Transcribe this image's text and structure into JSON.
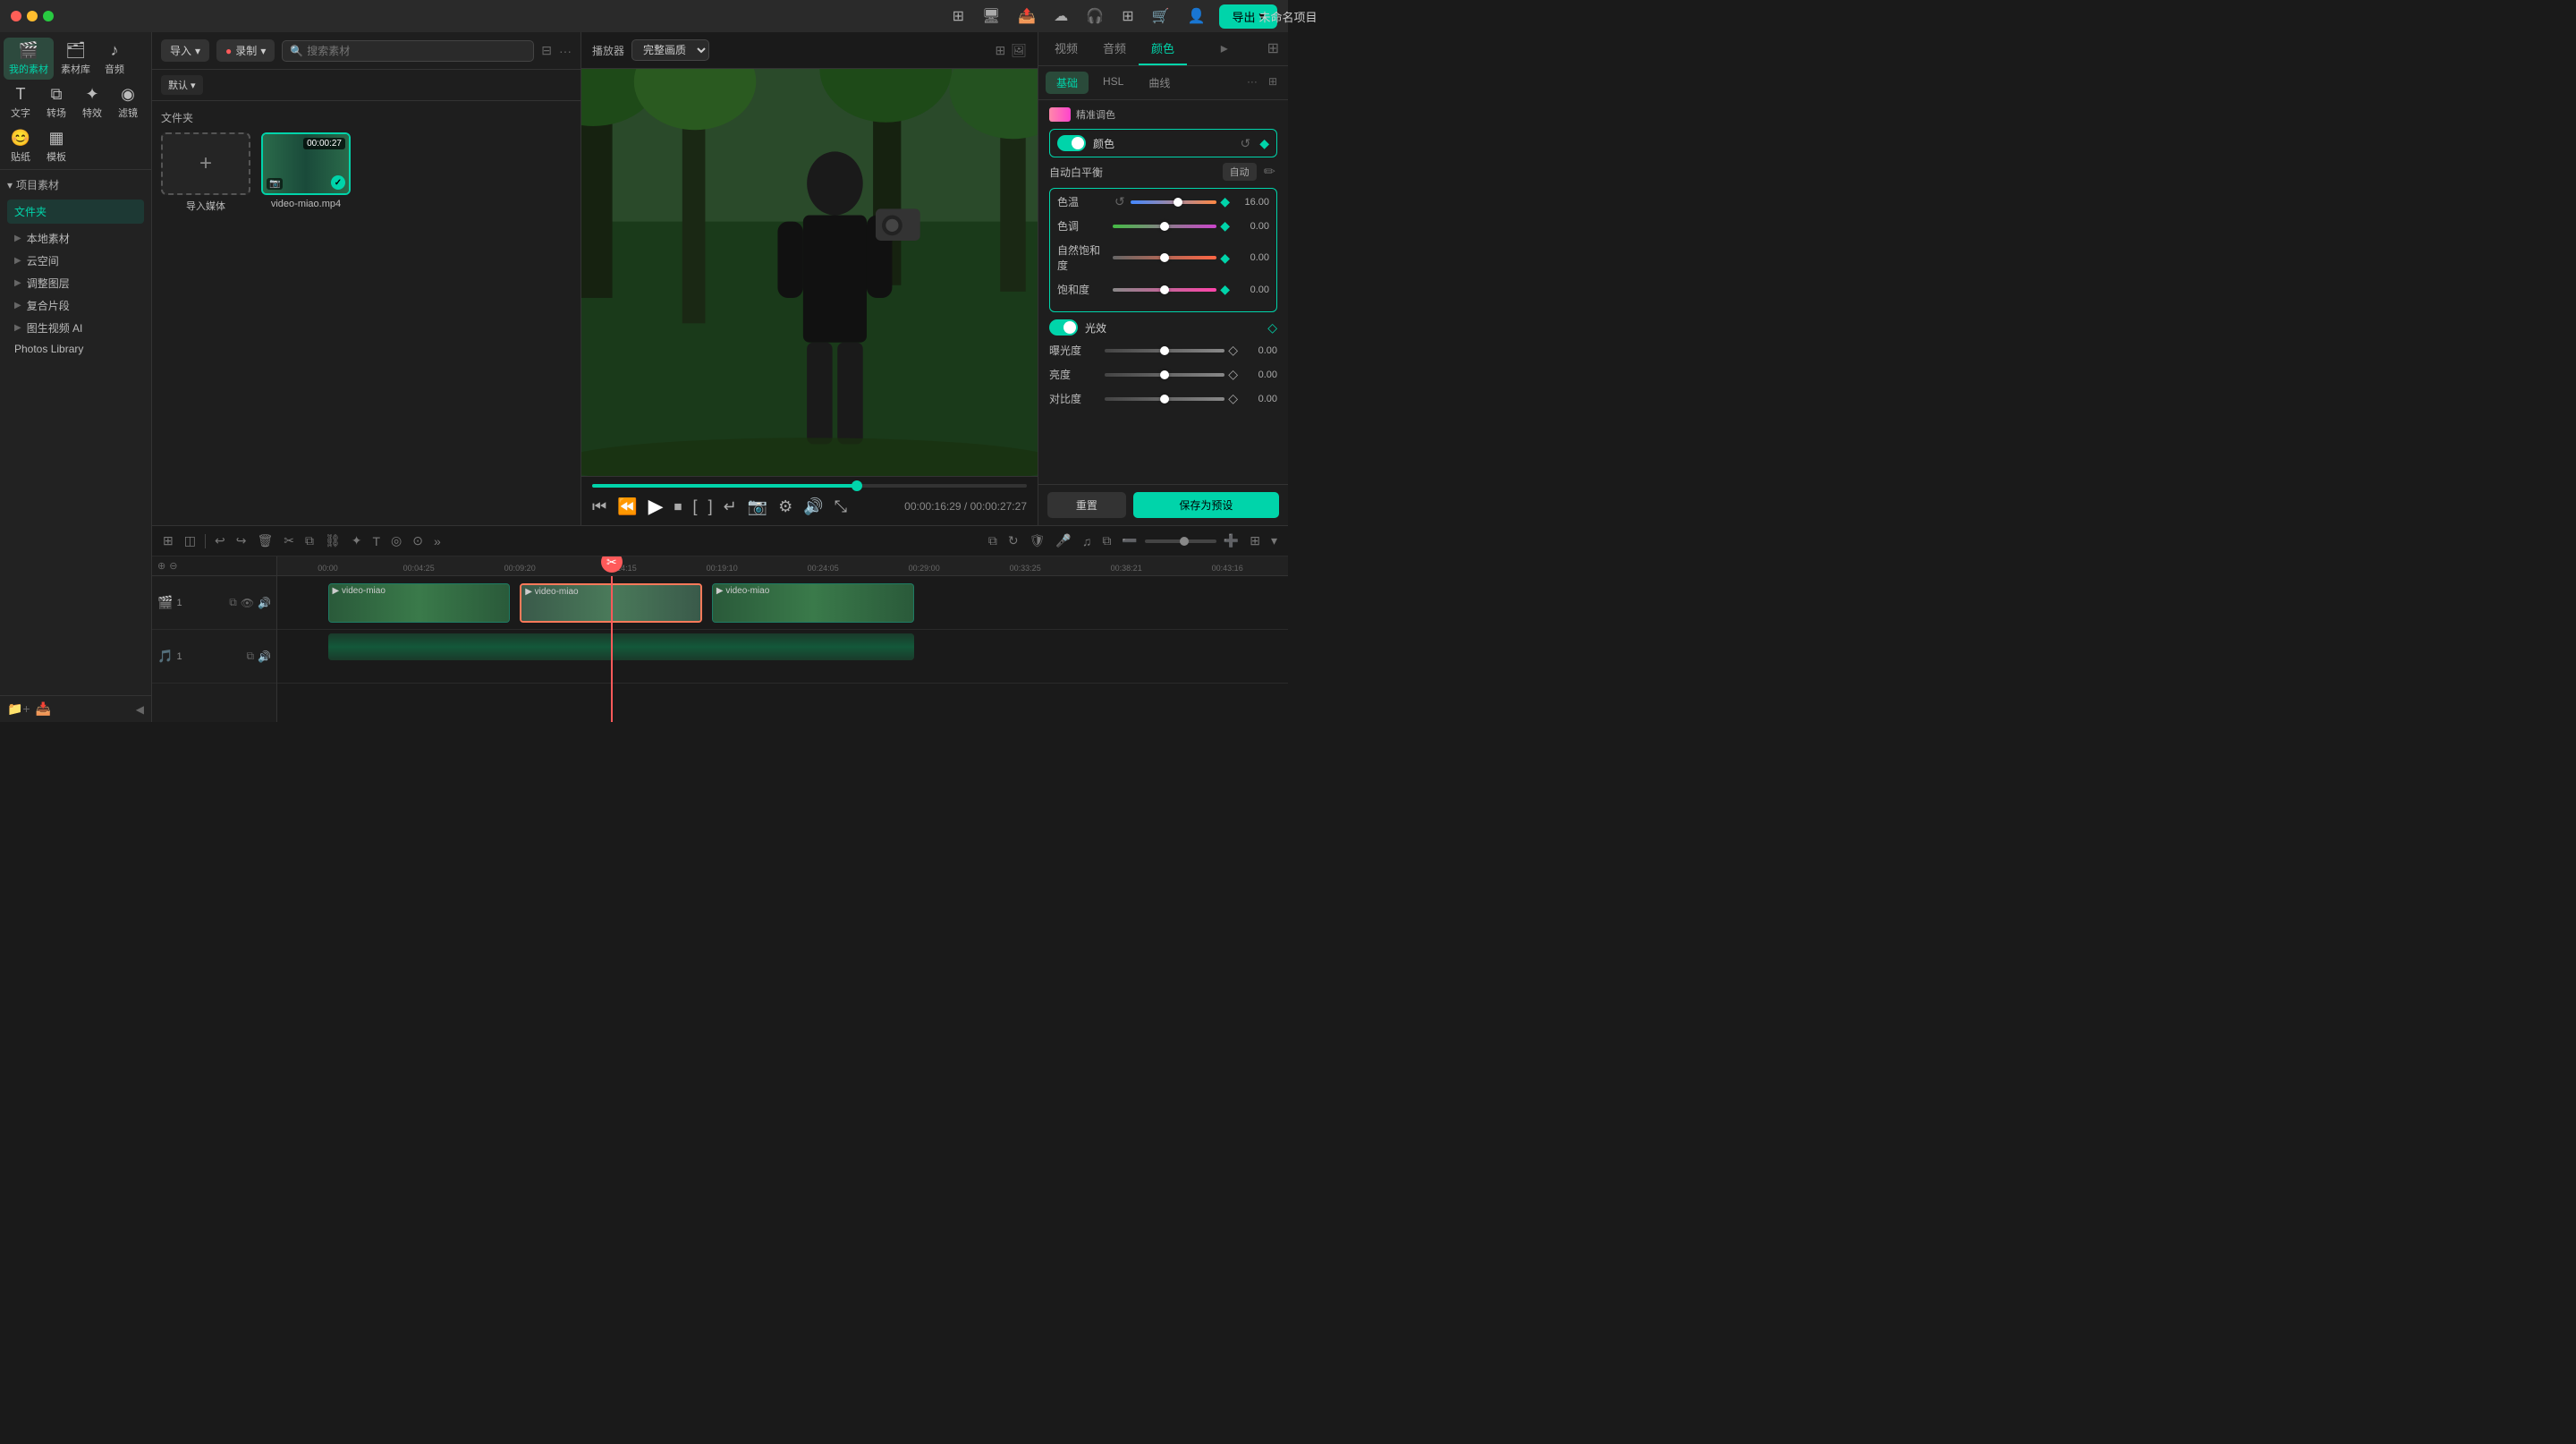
{
  "app": {
    "title": "未命名项目",
    "export_label": "导出",
    "traffic_lights": [
      "close",
      "minimize",
      "maximize"
    ]
  },
  "nav": {
    "items": [
      {
        "id": "my-material",
        "icon": "🎬",
        "label": "我的素材",
        "active": true
      },
      {
        "id": "material-lib",
        "icon": "🗂",
        "label": "素材库",
        "active": false
      },
      {
        "id": "audio",
        "icon": "🎵",
        "label": "音频",
        "active": false
      },
      {
        "id": "text",
        "icon": "T",
        "label": "文字",
        "active": false
      },
      {
        "id": "transition",
        "icon": "▶",
        "label": "转场",
        "active": false
      },
      {
        "id": "effects",
        "icon": "✨",
        "label": "特效",
        "active": false
      },
      {
        "id": "filters",
        "icon": "🔵",
        "label": "滤镜",
        "active": false
      },
      {
        "id": "sticker",
        "icon": "😊",
        "label": "贴纸",
        "active": false
      },
      {
        "id": "template",
        "icon": "□",
        "label": "模板",
        "active": false
      }
    ]
  },
  "sidebar": {
    "project_label": "项目素材",
    "folder_label": "文件夹",
    "items": [
      {
        "label": "本地素材",
        "has_arrow": true
      },
      {
        "label": "云空间",
        "has_arrow": true
      },
      {
        "label": "调整图层",
        "has_arrow": true
      },
      {
        "label": "复合片段",
        "has_arrow": true
      },
      {
        "label": "图生视频 AI",
        "has_arrow": true
      },
      {
        "label": "Photos Library",
        "has_arrow": false
      }
    ]
  },
  "media": {
    "import_label": "导入",
    "record_label": "录制",
    "sort_label": "默认",
    "search_placeholder": "搜索素材",
    "folder_label": "文件夹",
    "items": [
      {
        "type": "import",
        "label": "导入媒体"
      },
      {
        "type": "video",
        "name": "video-miao.mp4",
        "duration": "00:00:27",
        "has_check": true,
        "has_cam": true
      }
    ]
  },
  "preview": {
    "label": "播放器",
    "quality": "完整画质",
    "current_time": "00:00:16:29",
    "total_time": "00:00:27:27",
    "progress_percent": 61
  },
  "color_panel": {
    "tabs": [
      {
        "label": "视频",
        "active": false
      },
      {
        "label": "音频",
        "active": false
      },
      {
        "label": "颜色",
        "active": true
      }
    ],
    "sub_tabs": [
      {
        "label": "基础",
        "active": true
      },
      {
        "label": "HSL",
        "active": false
      },
      {
        "label": "曲线",
        "active": false
      }
    ],
    "color_section": {
      "toggle_label": "颜色",
      "auto_wb_label": "自动白平衡",
      "auto_btn_label": "自动",
      "sliders": [
        {
          "label": "色温",
          "value": "16.00",
          "percent": 55,
          "type": "temp"
        },
        {
          "label": "色调",
          "value": "0.00",
          "percent": 50,
          "type": "tint"
        },
        {
          "label": "自然饱和度",
          "value": "0.00",
          "percent": 50,
          "type": "vibrance"
        },
        {
          "label": "饱和度",
          "value": "0.00",
          "percent": 50,
          "type": "saturation"
        }
      ]
    },
    "light_section": {
      "toggle_label": "光效",
      "sliders": [
        {
          "label": "曝光度",
          "value": "0.00",
          "percent": 50
        },
        {
          "label": "亮度",
          "value": "0.00",
          "percent": 50
        },
        {
          "label": "对比度",
          "value": "0.00",
          "percent": 50
        }
      ]
    },
    "reset_label": "重置",
    "save_preset_label": "保存为预设"
  },
  "timeline": {
    "tools": [
      "split",
      "select",
      "undo",
      "redo",
      "delete",
      "cut",
      "crop",
      "link",
      "effects",
      "text",
      "mask",
      "motion"
    ],
    "ruler_marks": [
      "00:00",
      "00:04:25",
      "00:09:20",
      "00:14:15",
      "00:19:10",
      "00:24:05",
      "00:29:00",
      "00:33:25",
      "00:38:21",
      "00:43:16"
    ],
    "tracks": [
      {
        "id": "video1",
        "label": "视频 1",
        "icon": "📹",
        "clips": [
          {
            "label": "video-miao",
            "start_percent": 8,
            "width_percent": 16,
            "type": "video"
          },
          {
            "label": "video-miao",
            "start_percent": 24,
            "width_percent": 20,
            "type": "video",
            "active": true
          },
          {
            "label": "video-miao",
            "start_percent": 44,
            "width_percent": 20,
            "type": "video"
          }
        ]
      },
      {
        "id": "audio1",
        "label": "音频 1",
        "icon": "🎵",
        "clips": [
          {
            "label": "",
            "start_percent": 8,
            "width_percent": 56,
            "type": "audio"
          }
        ]
      }
    ],
    "playhead_percent": 33
  }
}
